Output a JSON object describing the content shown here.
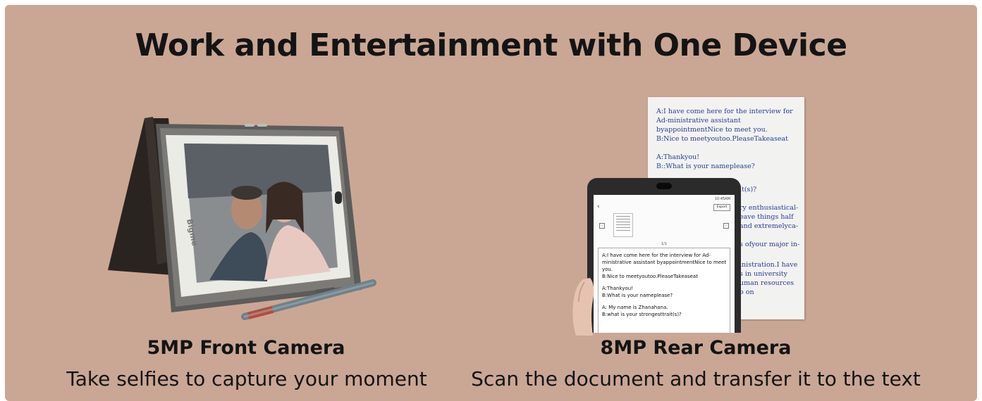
{
  "heading": "Work and Entertainment with One Device",
  "features": [
    {
      "title": "5MP Front Camera",
      "subtitle": "Take selfies to capture your moment"
    },
    {
      "title": "8MP Rear Camera",
      "subtitle": "Scan the document and transfer it to the text"
    }
  ],
  "front_illustration": {
    "brand": "Bigme"
  },
  "document": {
    "lines": [
      "A:I have come here for the interview for Ad-ministrative assistant byappointmentNice to meet you.",
      "B:Nice to meetyoutoo.PleaseTakeaseat",
      "A:Thankyou!",
      "B::What is your nameplease?",
      "it(s)?",
      "ry enthusiastical-",
      "eave things half",
      "and extremelyca-",
      "s ofyour major in-",
      "inistration.I have",
      "s in university",
      "uman resources",
      "o on"
    ]
  },
  "phone_screen": {
    "status": "10:45AM",
    "export_label": "Export",
    "page_indicator": "1/1",
    "ocr_paragraphs": [
      "A:I have come here for the interview for Ad-ministrative assistant byappointmentNice to meet you.",
      "B:Nice to meetyoutoo.PleaseTakeaseat",
      "A:Thankyou!",
      "B:What is your nameplease?",
      "A: My name is Zhanahana.",
      "B:what is your strongesttrait(s)?"
    ]
  },
  "colors": {
    "background": "#caa794",
    "text": "#141414",
    "document_ink": "#2a3b9a"
  }
}
